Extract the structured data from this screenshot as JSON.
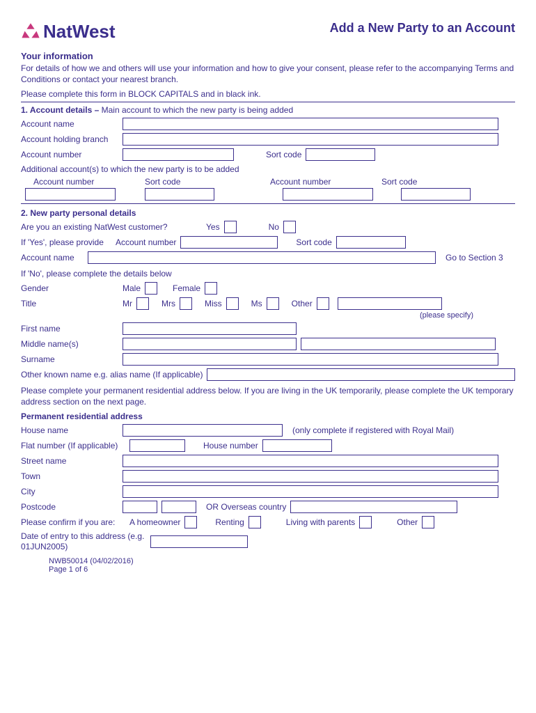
{
  "brand": "NatWest",
  "title": "Add a New Party to an Account",
  "yourInfo": {
    "heading": "Your information",
    "text": "For details of how we and others will use your information and how to give your consent, please refer to the accompanying Terms and Conditions or contact your nearest branch.",
    "instruction": "Please complete this form in BLOCK CAPITALS and in black ink."
  },
  "section1": {
    "heading": "1. Account details –",
    "sub": "Main account to which the new party is being added",
    "accountName": "Account name",
    "holdingBranch": "Account holding branch",
    "accountNumber": "Account number",
    "sortCode": "Sort code",
    "additional": "Additional account(s) to which the new party is to be added",
    "colAccountNumber": "Account number",
    "colSortCode": "Sort code"
  },
  "section2": {
    "heading": "2. New party personal details",
    "existingQ": "Are you an existing NatWest customer?",
    "yes": "Yes",
    "no": "No",
    "ifYes": "If 'Yes', please provide",
    "accountNumber": "Account number",
    "sortCode": "Sort code",
    "accountName": "Account name",
    "gotoSection3": "Go to Section 3",
    "ifNo": "If 'No', please complete the details below",
    "gender": "Gender",
    "male": "Male",
    "female": "Female",
    "titleLabel": "Title",
    "mr": "Mr",
    "mrs": "Mrs",
    "miss": "Miss",
    "ms": "Ms",
    "other": "Other",
    "pleaseSpecify": "(please specify)",
    "firstName": "First name",
    "middleNames": "Middle name(s)",
    "surname": "Surname",
    "otherKnown": "Other known name e.g. alias name (If applicable)",
    "addressInstr": "Please complete your permanent residential address below. If you are living in the UK temporarily, please complete the UK temporary address section on the next page.",
    "permAddr": "Permanent residential address",
    "houseName": "House name",
    "houseNameNote": "(only complete if registered with Royal Mail)",
    "flatNumber": "Flat number (If applicable)",
    "houseNumber": "House number",
    "streetName": "Street name",
    "town": "Town",
    "city": "City",
    "postcode": "Postcode",
    "orOverseas": "OR Overseas country",
    "confirmIf": "Please confirm if you are:",
    "homeowner": "A homeowner",
    "renting": "Renting",
    "livingParents": "Living with parents",
    "otherHousing": "Other",
    "dateEntry": "Date of entry to this address (e.g. 01JUN2005)"
  },
  "footer": {
    "ref": "NWB50014 (04/02/2016)",
    "page": "Page 1 of 6"
  }
}
